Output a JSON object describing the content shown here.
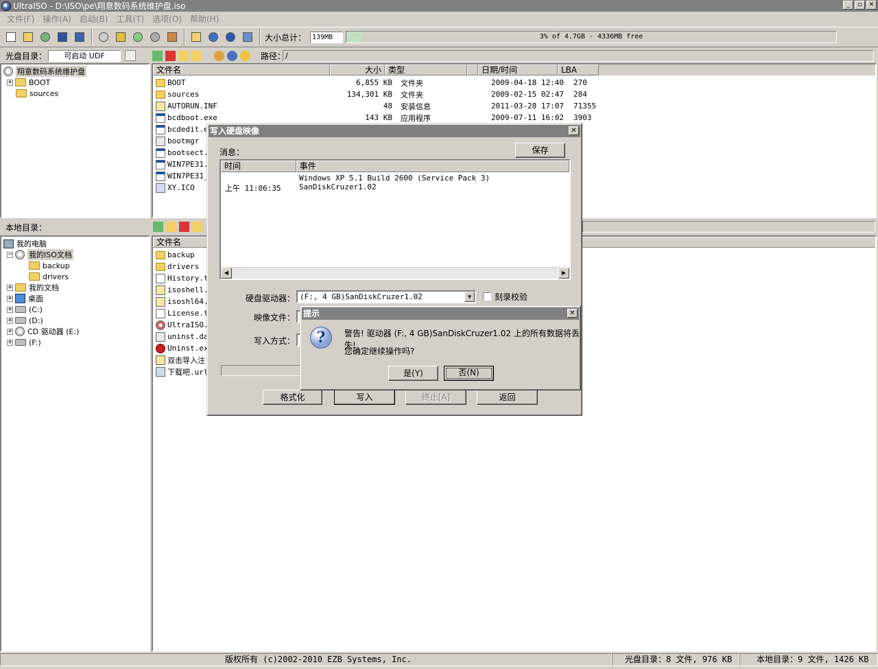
{
  "window": {
    "title": "UltraISO - D:\\ISO\\pe\\翔意数码系统维护盘.iso",
    "min": "_",
    "max": "▫",
    "close": "✕"
  },
  "menu": [
    "文件(F)",
    "操作(A)",
    "启动(B)",
    "工具(T)",
    "选项(O)",
    "帮助(H)"
  ],
  "toolbar": {
    "size_label": "大小总计：",
    "size_value": "139MB",
    "capacity_text": "3% of 4.7GB - 4336MB free",
    "capacity_fraction": 0.03
  },
  "iso_bar": {
    "label": "光盘目录：",
    "boot_type": "可启动 UDF",
    "path_label": "路径：",
    "path": "/"
  },
  "iso_tree": {
    "root": "翔意数码系统维护盘",
    "items": [
      "BOOT",
      "sources"
    ]
  },
  "iso_files": {
    "headers": [
      "文件名",
      "大小",
      "类型",
      "日期/时间",
      "LBA"
    ],
    "rows": [
      {
        "name": "BOOT",
        "size": "6,855 KB",
        "type": "文件夹",
        "date": "2009-04-18 12:40",
        "lba": "270",
        "icon": "folder"
      },
      {
        "name": "sources",
        "size": "134,301 KB",
        "type": "文件夹",
        "date": "2009-02-15 02:47",
        "lba": "284",
        "icon": "folder"
      },
      {
        "name": "AUTORUN.INF",
        "size": "48",
        "type": "安装信息",
        "date": "2011-03-28 17:07",
        "lba": "71355",
        "icon": "inf"
      },
      {
        "name": "bcdboot.exe",
        "size": "143 KB",
        "type": "应用程序",
        "date": "2009-07-11 16:02",
        "lba": "3903",
        "icon": "exe"
      },
      {
        "name": "bcdedit.ex",
        "size": "",
        "type": "",
        "date": "",
        "lba": "",
        "icon": "exe"
      },
      {
        "name": "bootmgr",
        "size": "",
        "type": "",
        "date": "",
        "lba": "",
        "icon": "sys"
      },
      {
        "name": "bootsect.e",
        "size": "",
        "type": "",
        "date": "",
        "lba": "",
        "icon": "exe"
      },
      {
        "name": "WIN7PE31.I",
        "size": "",
        "type": "",
        "date": "",
        "lba": "",
        "icon": "exe"
      },
      {
        "name": "WIN7PE31_x",
        "size": "",
        "type": "",
        "date": "",
        "lba": "",
        "icon": "exe"
      },
      {
        "name": "XY.ICO",
        "size": "",
        "type": "",
        "date": "",
        "lba": "",
        "icon": "ico"
      }
    ]
  },
  "local_bar": {
    "label": "本地目录："
  },
  "local_tree": {
    "items": [
      "我的电脑",
      "我的ISO文档",
      "backup",
      "drivers",
      "我的文档",
      "桌面",
      "(C:)",
      "(D:)",
      "CD 驱动器 (E:)",
      "(F:)"
    ]
  },
  "local_files": {
    "headers": [
      "文件名"
    ],
    "rows": [
      {
        "name": "backup",
        "icon": "folder"
      },
      {
        "name": "drivers",
        "icon": "folder"
      },
      {
        "name": "History.tx",
        "icon": "txt"
      },
      {
        "name": "isoshell.d",
        "icon": "inf"
      },
      {
        "name": "isoshl64.d",
        "icon": "inf"
      },
      {
        "name": "License.tx",
        "icon": "txt"
      },
      {
        "name": "UltraISO.c",
        "icon": "uiso"
      },
      {
        "name": "uninst.dat",
        "icon": "sys"
      },
      {
        "name": "Uninst.exe",
        "icon": "del"
      },
      {
        "name": "双击导入注",
        "icon": "inf"
      },
      {
        "name": "下载吧.url",
        "icon": "url"
      }
    ]
  },
  "status": {
    "copyright": "版权所有 (c)2002-2010 EZB Systems, Inc.",
    "iso_info": "光盘目录：8 文件, 976 KB",
    "local_info": "本地目录：9 文件, 1426 KB"
  },
  "write_dialog": {
    "title": "写入硬盘映像",
    "close": "✕",
    "msg_label": "消息：",
    "save": "保存",
    "log_headers": [
      "时间",
      "事件"
    ],
    "log": [
      {
        "time": "",
        "event": "Windows XP 5.1 Build 2600 (Service Pack 3)"
      },
      {
        "time": "上午 11:06:35",
        "event": "SanDiskCruzer1.02"
      }
    ],
    "drive_label": "硬盘驱动器：",
    "drive_value": "(F:, 4 GB)SanDiskCruzer1.02",
    "verify_label": "刻录校验",
    "image_label": "映像文件：",
    "mode_label": "写入方式：",
    "buttons": {
      "format": "格式化",
      "write": "写入",
      "stop": "终止[A]",
      "back": "返回"
    }
  },
  "prompt": {
    "title": "提示",
    "close": "✕",
    "icon": "?",
    "line1": "警告! 驱动器 (F:, 4 GB)SanDiskCruzer1.02 上的所有数据将丢失!",
    "line2": "您确定继续操作吗?",
    "yes": "是(Y)",
    "no": "否(N)"
  }
}
